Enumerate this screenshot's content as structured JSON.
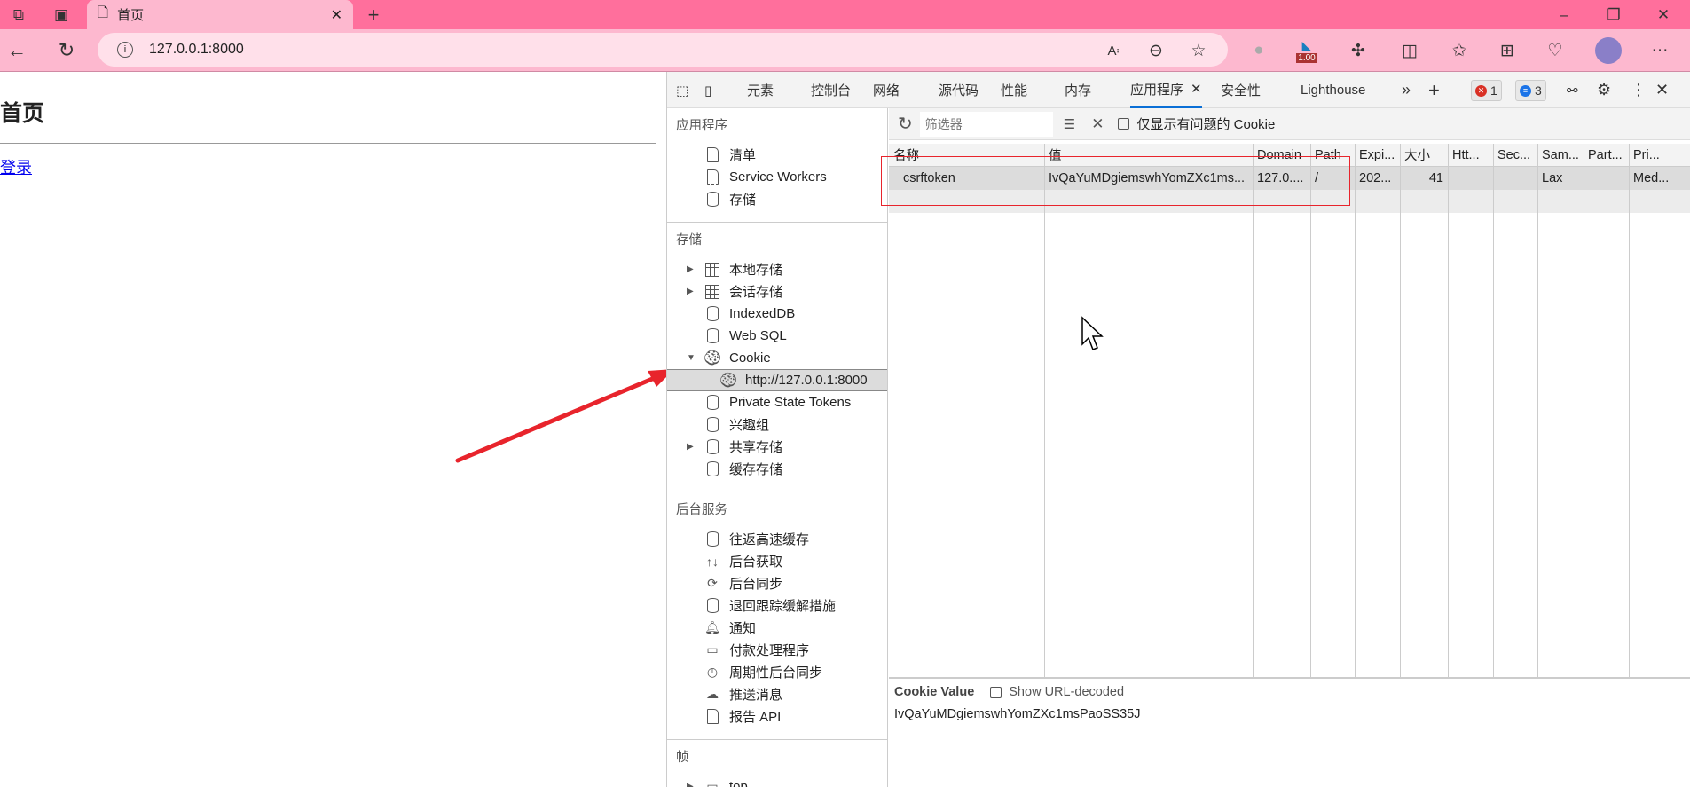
{
  "browser": {
    "tab_title": "首页",
    "url": "127.0.0.1:8000",
    "zoom_badge": "1.00",
    "colors": {
      "tabbar": "#ff6f9c",
      "toolbar": "#fdb8cf"
    }
  },
  "page": {
    "heading": "首页",
    "link": "登录"
  },
  "devtools": {
    "tabs": [
      "元素",
      "控制台",
      "网络",
      "源代码",
      "性能",
      "内存",
      "应用程序",
      "安全性",
      "Lighthouse"
    ],
    "active_tab": "应用程序",
    "errors": "1",
    "messages": "3",
    "sidebar": [
      {
        "heading": "应用程序",
        "items": [
          {
            "label": "清单",
            "icon": "doc"
          },
          {
            "label": "Service Workers",
            "icon": "gear"
          },
          {
            "label": "存储",
            "icon": "cyl"
          }
        ]
      },
      {
        "heading": "存储",
        "items": [
          {
            "label": "本地存储",
            "icon": "grid",
            "tri": "right"
          },
          {
            "label": "会话存储",
            "icon": "grid",
            "tri": "right"
          },
          {
            "label": "IndexedDB",
            "icon": "cyl"
          },
          {
            "label": "Web SQL",
            "icon": "cyl"
          },
          {
            "label": "Cookie",
            "icon": "cookie",
            "tri": "down"
          },
          {
            "label": "http://127.0.0.1:8000",
            "icon": "cookie",
            "selected": true,
            "indent": true
          },
          {
            "label": "Private State Tokens",
            "icon": "cyl"
          },
          {
            "label": "兴趣组",
            "icon": "cyl"
          },
          {
            "label": "共享存储",
            "icon": "cyl",
            "tri": "right"
          },
          {
            "label": "缓存存储",
            "icon": "cyl"
          }
        ]
      },
      {
        "heading": "后台服务",
        "items": [
          {
            "label": "往返高速缓存",
            "icon": "cyl"
          },
          {
            "label": "后台获取",
            "icon": "arrows"
          },
          {
            "label": "后台同步",
            "icon": "sync"
          },
          {
            "label": "退回跟踪缓解措施",
            "icon": "cyl"
          },
          {
            "label": "通知",
            "icon": "bell"
          },
          {
            "label": "付款处理程序",
            "icon": "card"
          },
          {
            "label": "周期性后台同步",
            "icon": "clock"
          },
          {
            "label": "推送消息",
            "icon": "cloud"
          },
          {
            "label": "报告 API",
            "icon": "doc"
          }
        ]
      },
      {
        "heading": "帧",
        "items": [
          {
            "label": "top",
            "icon": "frame",
            "tri": "right"
          }
        ]
      }
    ],
    "filter_placeholder": "筛选器",
    "only_issues_label": "仅显示有问题的 Cookie",
    "columns": [
      "名称",
      "值",
      "Domain",
      "Path",
      "Expi...",
      "大小",
      "Htt...",
      "Sec...",
      "Sam...",
      "Part...",
      "Pri..."
    ],
    "rows": [
      [
        "csrftoken",
        "IvQaYuMDgiemswhYomZXc1ms...",
        "127.0....",
        "/",
        "202...",
        "41",
        "",
        "",
        "Lax",
        "",
        "Med..."
      ]
    ],
    "cookie_value_label": "Cookie Value",
    "show_decoded_label": "Show URL-decoded",
    "cookie_value": "IvQaYuMDgiemswhYomZXc1msPaoSS35J",
    "annotation_color": "#e8242c"
  }
}
